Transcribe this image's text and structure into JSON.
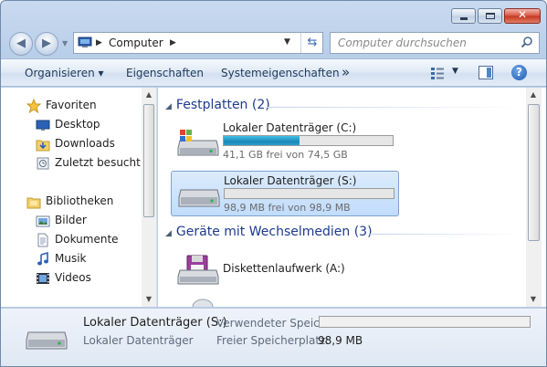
{
  "window": {
    "buttons": {
      "minimize": "",
      "maximize": "",
      "close": "✕"
    }
  },
  "address": {
    "location": "Computer",
    "search_placeholder": "Computer durchsuchen"
  },
  "toolbar": {
    "organize_label": "Organisieren ▾",
    "properties_label": "Eigenschaften",
    "system_properties_label": "Systemeigenschaften",
    "more_label": "»",
    "help_label": "?"
  },
  "sidebar": {
    "favorites": {
      "label": "Favoriten",
      "icon": "star-icon"
    },
    "favorite_items": [
      {
        "label": "Desktop",
        "icon": "desktop-icon"
      },
      {
        "label": "Downloads",
        "icon": "downloads-icon"
      },
      {
        "label": "Zuletzt besucht",
        "icon": "recent-places-icon"
      }
    ],
    "libraries": {
      "label": "Bibliotheken",
      "icon": "libraries-icon"
    },
    "library_items": [
      {
        "label": "Bilder",
        "icon": "pictures-icon"
      },
      {
        "label": "Dokumente",
        "icon": "documents-icon"
      },
      {
        "label": "Musik",
        "icon": "music-icon"
      },
      {
        "label": "Videos",
        "icon": "videos-icon"
      }
    ]
  },
  "main": {
    "groups": [
      {
        "title": "Festplatten (2)",
        "items": [
          {
            "name": "Lokaler Datenträger (C:)",
            "free_text": "41,1 GB frei von 74,5 GB",
            "used_fraction": 0.45,
            "selected": false
          },
          {
            "name": "Lokaler Datenträger (S:)",
            "free_text": "98,9 MB frei von 98,9 MB",
            "used_fraction": 0.0,
            "selected": true
          }
        ]
      },
      {
        "title": "Geräte mit Wechselmedien (3)",
        "items": [
          {
            "name": "Diskettenlaufwerk (A:)"
          }
        ]
      }
    ]
  },
  "details": {
    "title": "Lokaler Datenträger (S:)",
    "subtitle": "Lokaler Datenträger",
    "used_label": "Verwendeter Speic...",
    "used_fraction": 0.0,
    "free_label": "Freier Speicherplatz:",
    "free_value": "98,9 MB"
  },
  "colors": {
    "accent": "#1e3a8c",
    "bar_fill": "#26a0cc",
    "selection": "#c1dcfc"
  }
}
